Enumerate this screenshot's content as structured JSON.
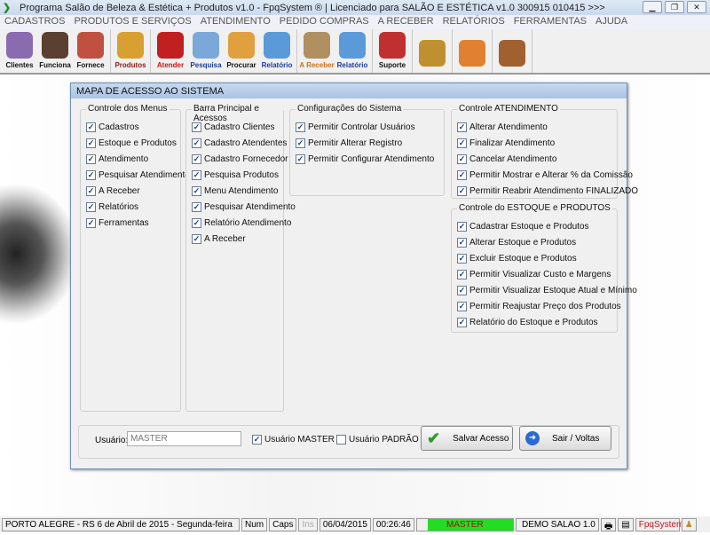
{
  "window": {
    "title": "Programa Salão de Beleza & Estética + Produtos v1.0 - FpqSystem ® | Licenciado para  SALÃO E ESTÉTICA v1.0 300915 010415 >>>"
  },
  "menu": [
    "CADASTROS",
    "PRODUTOS E SERVIÇOS",
    "ATENDIMENTO",
    "PEDIDO COMPRAS",
    "A RECEBER",
    "RELATÓRIOS",
    "FERRAMENTAS",
    "AJUDA"
  ],
  "toolbar": [
    {
      "label": "Clientes",
      "color": "#111111",
      "icon": "#8a6bb0"
    },
    {
      "label": "Funciona",
      "color": "#111111",
      "icon": "#5a4030"
    },
    {
      "label": "Fornece",
      "color": "#111111",
      "icon": "#c05040"
    },
    {
      "label": "Produtos",
      "color": "#8b1a1a",
      "icon": "#d8a030"
    },
    {
      "label": "Atender",
      "color": "#cc1111",
      "icon": "#c02020"
    },
    {
      "label": "Pesquisa",
      "color": "#1a3b9a",
      "icon": "#7aa8d8"
    },
    {
      "label": "Procurar",
      "color": "#111111",
      "icon": "#e0a040"
    },
    {
      "label": "Relatório",
      "color": "#1a3b9a",
      "icon": "#5a9ad8"
    },
    {
      "label": "A Receber",
      "color": "#c87020",
      "icon": "#b09060"
    },
    {
      "label": "Relatório",
      "color": "#1a3b9a",
      "icon": "#5a9ad8"
    },
    {
      "label": "Suporte",
      "color": "#111111",
      "icon": "#c03030"
    },
    {
      "label": "",
      "color": "#111111",
      "icon": "#c09030"
    },
    {
      "label": "",
      "color": "#111111",
      "icon": "#e08030"
    },
    {
      "label": "",
      "color": "#111111",
      "icon": "#a06030"
    }
  ],
  "dialog": {
    "title": "MAPA DE ACESSO AO SISTEMA",
    "groups": {
      "menus": {
        "title": "Controle dos Menus",
        "items": [
          "Cadastros",
          "Estoque e Produtos",
          "Atendimento",
          "Pesquisar Atendimento",
          "A Receber",
          "Relatórios",
          "Ferramentas"
        ]
      },
      "barra": {
        "title": "Barra Principal e Acessos",
        "items": [
          "Cadastro Clientes",
          "Cadastro Atendentes",
          "Cadastro Fornecedor",
          "Pesquisa Produtos",
          "Menu Atendimento",
          "Pesquisar Atendimento",
          "Relatório Atendimento",
          "A Receber"
        ]
      },
      "config": {
        "title": "Configurações do Sistema",
        "items": [
          "Permitir Controlar Usuários",
          "Permitir Alterar Registro",
          "Permitir Configurar Atendimento"
        ]
      },
      "atend": {
        "title": "Controle ATENDIMENTO",
        "items": [
          "Alterar Atendimento",
          "Finalizar Atendimento",
          "Cancelar Atendimento",
          "Permitir Mostrar e Alterar % da Comissão",
          "Permitir Reabrir Atendimento FINALIZADO"
        ]
      },
      "estoque": {
        "title": "Controle do ESTOQUE e PRODUTOS",
        "items": [
          "Cadastrar Estoque e Produtos",
          "Alterar Estoque e Produtos",
          "Excluir Estoque e Produtos",
          "Permitir Visualizar Custo e Margens",
          "Permitir Visualizar Estoque Atual e Mínimo",
          "Permitir Reajustar Preço dos Produtos",
          "Relatório do Estoque e Produtos"
        ]
      }
    },
    "user_label": "Usuário:",
    "user_value": "MASTER",
    "master_label": "Usuário MASTER",
    "master_checked": true,
    "padrao_label": "Usuário PADRÃO",
    "padrao_checked": false,
    "save_label": "Salvar Acesso",
    "exit_label": "Sair / Voltas"
  },
  "status": {
    "location": "PORTO ALEGRE - RS  6 de Abril de 2015 - Segunda-feira",
    "num": "Num",
    "caps": "Caps",
    "ins": "Ins",
    "date": "06/04/2015",
    "time": "00:26:46",
    "user": "MASTER",
    "demo": "DEMO SALAO 1.0",
    "brand": "FpqSystem"
  }
}
